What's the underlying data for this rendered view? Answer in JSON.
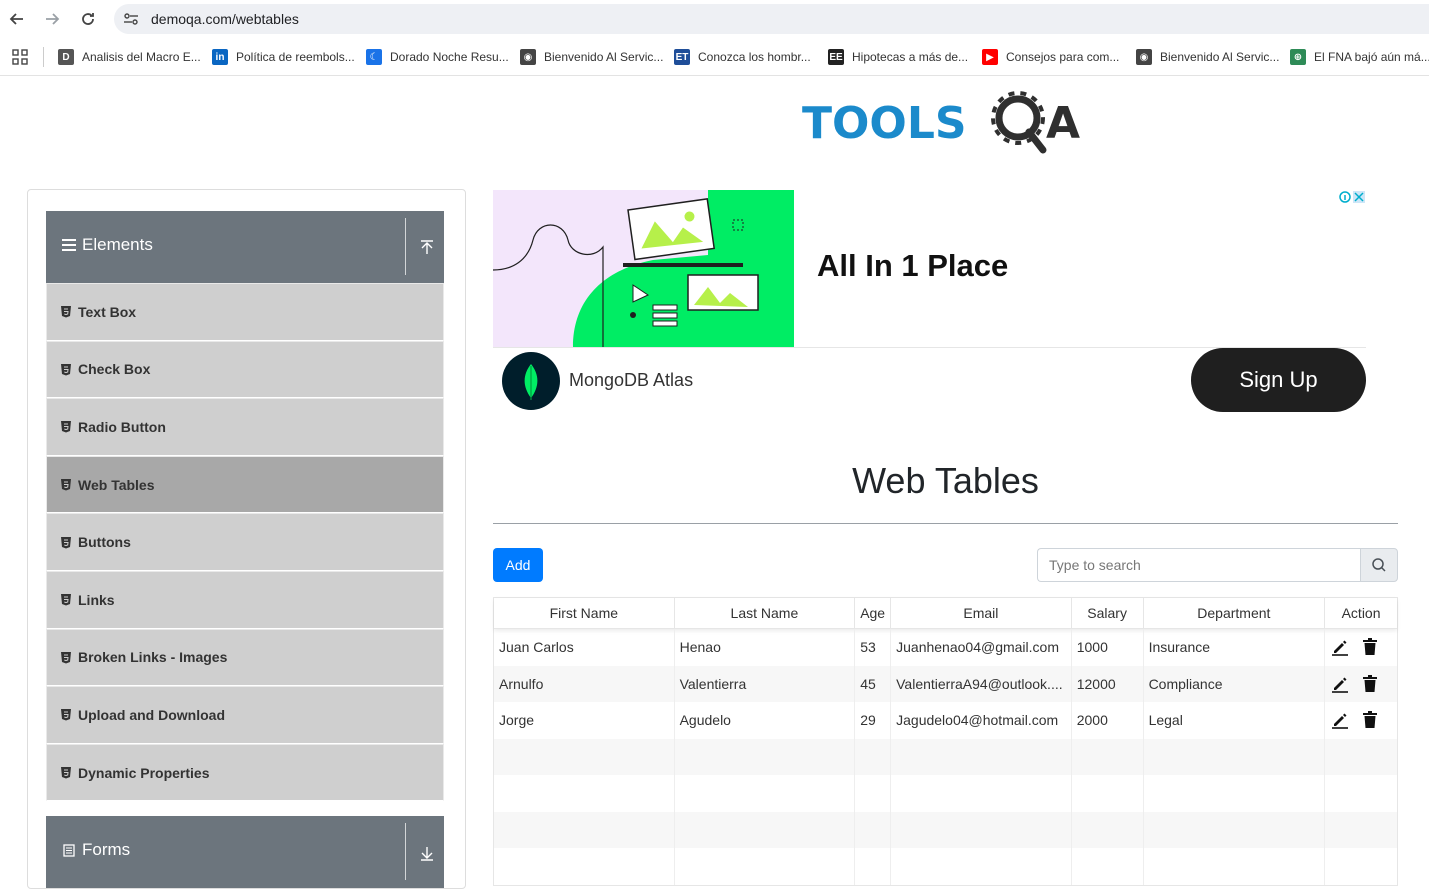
{
  "browser": {
    "url": "demoqa.com/webtables",
    "bookmarks": [
      {
        "label": "Analisis del Macro E...",
        "icon": "d-favicon",
        "color": "#555555"
      },
      {
        "label": "Política de reembols...",
        "icon": "linkedin-favicon",
        "color": "#0a66c2"
      },
      {
        "label": "Dorado Noche Resu...",
        "icon": "moon-favicon",
        "color": "#1a73e8"
      },
      {
        "label": "Bienvenido Al Servic...",
        "icon": "globe-favicon",
        "color": "#444444"
      },
      {
        "label": "Conozca los hombr...",
        "icon": "et-favicon",
        "color": "#1f4e99"
      },
      {
        "label": "Hipotecas a más de...",
        "icon": "ee-favicon",
        "color": "#222222"
      },
      {
        "label": "Consejos para com...",
        "icon": "youtube-favicon",
        "color": "#ff0000"
      },
      {
        "label": "Bienvenido Al Servic...",
        "icon": "globe-favicon",
        "color": "#444444"
      },
      {
        "label": "El FNA bajó aún má...",
        "icon": "world-favicon",
        "color": "#2e8b57"
      }
    ]
  },
  "logo": {
    "text_left": "TOOLS",
    "text_right": "A",
    "color": "#1b8acb"
  },
  "sidebar": {
    "elements_title": "Elements",
    "forms_title": "Forms",
    "items": [
      {
        "label": "Text Box",
        "active": false
      },
      {
        "label": "Check Box",
        "active": false
      },
      {
        "label": "Radio Button",
        "active": false
      },
      {
        "label": "Web Tables",
        "active": true
      },
      {
        "label": "Buttons",
        "active": false
      },
      {
        "label": "Links",
        "active": false
      },
      {
        "label": "Broken Links - Images",
        "active": false
      },
      {
        "label": "Upload and Download",
        "active": false
      },
      {
        "label": "Dynamic Properties",
        "active": false
      }
    ]
  },
  "ad": {
    "headline": "All In 1 Place",
    "brand": "MongoDB Atlas",
    "cta": "Sign Up"
  },
  "main": {
    "title": "Web Tables",
    "add_label": "Add",
    "search_placeholder": "Type to search",
    "columns": [
      "First Name",
      "Last Name",
      "Age",
      "Email",
      "Salary",
      "Department",
      "Action"
    ],
    "rows": [
      [
        "Juan Carlos",
        "Henao",
        "53",
        "Juanhenao04@gmail.com",
        "1000",
        "Insurance"
      ],
      [
        "Arnulfo",
        "Valentierra",
        "45",
        "ValentierraA94@outlook....",
        "12000",
        "Compliance"
      ],
      [
        "Jorge",
        "Agudelo",
        "29",
        "Jagudelo04@hotmail.com",
        "2000",
        "Legal"
      ]
    ],
    "empty_rows": 4
  }
}
